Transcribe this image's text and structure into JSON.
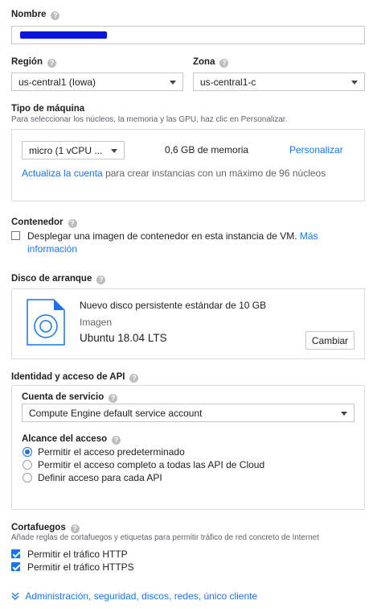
{
  "name": {
    "label": "Nombre",
    "value": ""
  },
  "region": {
    "label": "Región",
    "value": "us-central1 (Iowa)"
  },
  "zone": {
    "label": "Zona",
    "value": "us-central1-c"
  },
  "machine": {
    "label": "Tipo de máquina",
    "hint": "Para seleccionar los núcleos, la memoria y las GPU, haz clic en Personalizar.",
    "type_value": "micro (1 vCPU ...",
    "memory": "0,6 GB de memoria",
    "customize": "Personalizar",
    "upgrade_link": "Actualiza la cuenta",
    "upgrade_text": "para crear instancias con un máximo de 96 núcleos"
  },
  "container": {
    "label": "Contenedor",
    "checkbox_text": "Desplegar una imagen de contenedor en esta instancia de VM.",
    "more_link_1": "Más",
    "more_link_2": "información"
  },
  "boot_disk": {
    "label": "Disco de arranque",
    "title": "Nuevo disco persistente estándar de 10 GB",
    "image_label": "Imagen",
    "image_value": "Ubuntu 18.04 LTS",
    "change_button": "Cambiar"
  },
  "identity": {
    "label": "Identidad y acceso de API",
    "service_account_label": "Cuenta de servicio",
    "service_account_value": "Compute Engine default service account",
    "scope_label": "Alcance del acceso",
    "scopes": [
      {
        "label": "Permitir el acceso predeterminado",
        "selected": true
      },
      {
        "label": "Permitir el acceso completo a todas las API de Cloud",
        "selected": false
      },
      {
        "label": "Definir acceso para cada API",
        "selected": false
      }
    ]
  },
  "firewall": {
    "label": "Cortafuegos",
    "hint": "Añade reglas de cortafuegos y etiquetas para permitir tráfico de red concreto de Internet",
    "http": {
      "label": "Permitir el tráfico HTTP",
      "checked": true
    },
    "https": {
      "label": "Permitir el tráfico HTTPS",
      "checked": true
    }
  },
  "more_options": "Administración, seguridad, discos, redes, único cliente",
  "colors": {
    "accent": "#1a73e8",
    "redaction": "#0a14d8"
  }
}
